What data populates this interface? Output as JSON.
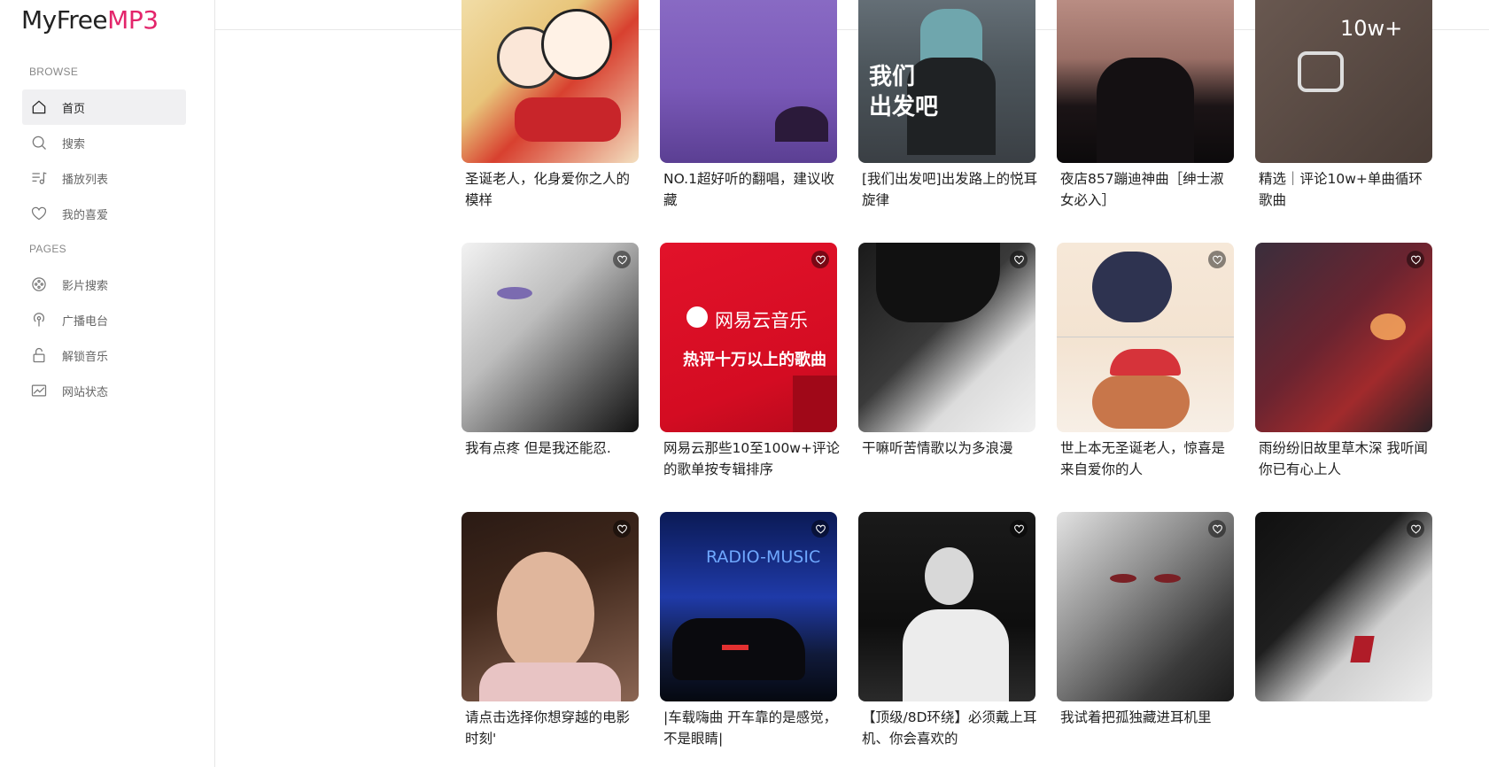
{
  "app": {
    "logo_part1": "MyFree",
    "logo_part2": "MP3"
  },
  "sidebar": {
    "browse_title": "BROWSE",
    "pages_title": "PAGES",
    "browse": [
      {
        "label": "首页",
        "icon": "home-icon",
        "active": true
      },
      {
        "label": "搜索",
        "icon": "search-icon"
      },
      {
        "label": "播放列表",
        "icon": "playlist-icon"
      },
      {
        "label": "我的喜爱",
        "icon": "heart-icon"
      }
    ],
    "pages": [
      {
        "label": "影片搜索",
        "icon": "film-reel-icon"
      },
      {
        "label": "广播电台",
        "icon": "radio-icon"
      },
      {
        "label": "解锁音乐",
        "icon": "unlock-icon"
      },
      {
        "label": "网站状态",
        "icon": "status-icon"
      }
    ]
  },
  "cover_texts": {
    "c3": "我们\n出发吧",
    "c5": "10w+",
    "c7_brand": "网易云音乐",
    "c7_sub": "热评十万以上的歌曲",
    "c12": "RADIO-MUSIC"
  },
  "playlists": [
    {
      "title": "圣诞老人，化身爱你之人的模样"
    },
    {
      "title": "NO.1超好听的翻唱，建议收藏"
    },
    {
      "title": "[我们出发吧]出发路上的悦耳旋律"
    },
    {
      "title": "夜店857蹦迪神曲［绅士淑女必入］"
    },
    {
      "title": "精选｜评论10w+单曲循环歌曲"
    },
    {
      "title": "我有点疼 但是我还能忍."
    },
    {
      "title": "网易云那些10至100w+评论的歌单按专辑排序"
    },
    {
      "title": "干嘛听苦情歌以为多浪漫"
    },
    {
      "title": "世上本无圣诞老人，惊喜是来自爱你的人"
    },
    {
      "title": "雨纷纷旧故里草木深 我听闻你已有心上人"
    },
    {
      "title": "请点击选择你想穿越的电影时刻'"
    },
    {
      "title": "|车载嗨曲 开车靠的是感觉，不是眼睛|"
    },
    {
      "title": "【顶级/8D环绕】必须戴上耳机、你会喜欢的"
    },
    {
      "title": "我试着把孤独藏进耳机里"
    },
    {
      "title": ""
    }
  ]
}
